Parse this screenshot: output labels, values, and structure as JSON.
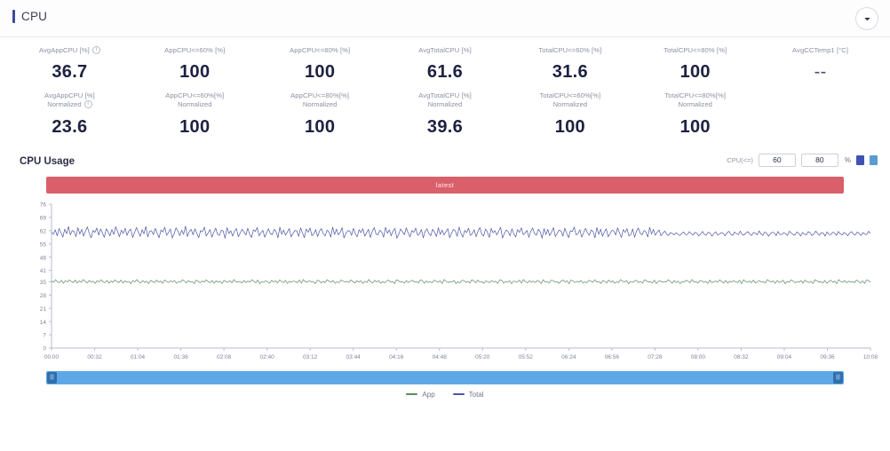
{
  "header": {
    "title": "CPU",
    "collapse_icon": "chevron-down-icon"
  },
  "kpis": {
    "row1": [
      {
        "label": "AvgAppCPU [%]",
        "info": true,
        "value": "36.7"
      },
      {
        "label": "AppCPU<=60% [%]",
        "info": false,
        "value": "100"
      },
      {
        "label": "AppCPU<=80% [%]",
        "info": false,
        "value": "100"
      },
      {
        "label": "AvgTotalCPU [%]",
        "info": false,
        "value": "61.6"
      },
      {
        "label": "TotalCPU<=60% [%]",
        "info": false,
        "value": "31.6"
      },
      {
        "label": "TotalCPU<=80% [%]",
        "info": false,
        "value": "100"
      },
      {
        "label": "AvgCCTemp1 [°C]",
        "info": false,
        "value": "--"
      }
    ],
    "row2": [
      {
        "label": "AvgAppCPU [%]",
        "sub": "Normalized",
        "info": true,
        "value": "23.6"
      },
      {
        "label": "AppCPU<=60%[%]",
        "sub": "Normalized",
        "info": false,
        "value": "100"
      },
      {
        "label": "AppCPU<=80%[%]",
        "sub": "Normalized",
        "info": false,
        "value": "100"
      },
      {
        "label": "AvgTotalCPU [%]",
        "sub": "Normalized",
        "info": false,
        "value": "39.6"
      },
      {
        "label": "TotalCPU<=60%[%]",
        "sub": "Normalized",
        "info": false,
        "value": "100"
      },
      {
        "label": "TotalCPU<=80%[%]",
        "sub": "Normalized",
        "info": false,
        "value": "100"
      },
      {
        "label": "",
        "sub": "",
        "info": false,
        "value": ""
      }
    ]
  },
  "chart_section": {
    "title": "CPU Usage",
    "controls": {
      "label": "CPU(<=)",
      "threshold_low": "60",
      "threshold_high": "80",
      "unit": "%",
      "icon_a": "bar-chart-icon",
      "icon_b": "line-chart-icon"
    },
    "alert_banner": {
      "text": "latest",
      "color": "#d9606a"
    },
    "legend_position": "bottom-center",
    "range_slider": {
      "left_handle": "range-start-handle",
      "right_handle": "range-end-handle",
      "fill_color": "#5fa8e8"
    }
  },
  "chart_data": {
    "type": "line",
    "title": "CPU Usage",
    "xlabel": "",
    "ylabel": "",
    "grid": false,
    "ylim": [
      0,
      76
    ],
    "yticks": [
      0,
      7,
      14,
      21,
      28,
      35,
      41,
      48,
      55,
      62,
      69,
      76
    ],
    "ytick_labels": [
      "0",
      "7",
      "14",
      "21",
      "28",
      "35",
      "41",
      "48",
      "55",
      "62",
      "69",
      "76"
    ],
    "xticks": [
      "00:00",
      "00:32",
      "01:04",
      "01:36",
      "02:08",
      "02:40",
      "03:12",
      "03:44",
      "04:16",
      "04:48",
      "05:20",
      "05:52",
      "06:24",
      "06:56",
      "07:28",
      "08:00",
      "08:32",
      "09:04",
      "09:36",
      "10:08"
    ],
    "series": [
      {
        "name": "Total",
        "color": "#4a55a8",
        "values": [
          61.2,
          60.1,
          62.4,
          59.3,
          63.1,
          61.0,
          58.6,
          62.8,
          60.4,
          64.2,
          59.8,
          62.1,
          61.5,
          58.9,
          63.6,
          60.2,
          62.7,
          59.1,
          61.8,
          64.0,
          60.6,
          58.3,
          62.2,
          61.1,
          63.4,
          59.7,
          62.9,
          60.8,
          58.5,
          63.0,
          61.4,
          59.2,
          62.6,
          60.0,
          64.1,
          61.7,
          58.8,
          62.3,
          60.5,
          63.3,
          59.5,
          61.9,
          62.8,
          58.4,
          60.9,
          63.7,
          61.2,
          59.0,
          62.5,
          60.3,
          64.3,
          58.7,
          61.6,
          62.0,
          59.9,
          63.2,
          60.7,
          58.2,
          62.4,
          61.3,
          63.8,
          59.6,
          61.0,
          62.9,
          58.1,
          60.4,
          63.5,
          61.8,
          59.4,
          62.2,
          60.1,
          64.4,
          58.9,
          61.5,
          62.7,
          59.8,
          63.0,
          60.6,
          58.3,
          62.1,
          61.4,
          63.9,
          59.2,
          60.8,
          62.6,
          58.6,
          61.1,
          63.4,
          60.0,
          59.5,
          62.3,
          61.7,
          58.0,
          63.6,
          60.5,
          62.0,
          59.1,
          61.9,
          63.1,
          58.8,
          60.7,
          62.8,
          61.2,
          59.7,
          63.3,
          60.2,
          58.4,
          62.5,
          61.6,
          63.7,
          59.3,
          60.9,
          62.2,
          58.5,
          61.0,
          63.0,
          60.4,
          59.9,
          62.7,
          61.5,
          58.2,
          63.8,
          60.1,
          62.4,
          59.6,
          61.3,
          63.2,
          58.7,
          60.6,
          62.1,
          61.8,
          59.0,
          63.5,
          60.8,
          58.3,
          62.9,
          61.1,
          63.4,
          59.4,
          60.3,
          62.6,
          58.9,
          61.7,
          63.1,
          60.5,
          59.2,
          62.3,
          61.4,
          58.6,
          63.9,
          60.0,
          62.8,
          59.8,
          61.2,
          63.6,
          58.1,
          60.7,
          62.0,
          61.9,
          59.5,
          63.3,
          60.4,
          58.8,
          62.5,
          61.0,
          63.0,
          59.1,
          60.9,
          62.7,
          58.4,
          61.6,
          63.7,
          60.2,
          59.7,
          62.2,
          61.3,
          58.5,
          63.8,
          60.6,
          62.4,
          59.3,
          61.8,
          63.2,
          58.0,
          60.1,
          62.9,
          61.5,
          59.9,
          63.5,
          60.8,
          58.7,
          62.1,
          61.1,
          63.4,
          59.6,
          60.3,
          62.6,
          58.2,
          61.7,
          63.0,
          60.5,
          59.4,
          62.8,
          61.2,
          58.9,
          63.6,
          60.0,
          62.3,
          59.8,
          61.4,
          63.1,
          58.3,
          60.7,
          62.7,
          61.9,
          59.0,
          63.9,
          60.6,
          58.6,
          62.2,
          61.0,
          63.3,
          59.5,
          60.4,
          62.5,
          58.8,
          61.6,
          63.7,
          60.1,
          59.2,
          62.9,
          61.3,
          58.4,
          63.2,
          60.9,
          62.0,
          59.7,
          61.8,
          63.8,
          58.1,
          60.5,
          62.4,
          61.5,
          59.3,
          63.0,
          60.2,
          58.7,
          62.6,
          61.1,
          63.5,
          59.9,
          60.8,
          62.1,
          58.5,
          61.7,
          63.4,
          60.3,
          59.6,
          62.8,
          61.4,
          58.0,
          63.1,
          60.0,
          62.7,
          59.4,
          61.2,
          63.6,
          58.9,
          60.6,
          62.3,
          61.8,
          59.1,
          63.3,
          60.7,
          58.3,
          62.0,
          61.5,
          63.9,
          59.8,
          60.4,
          62.5,
          58.6,
          61.0,
          63.2,
          60.9,
          59.5,
          62.4,
          61.6,
          58.2,
          63.7,
          60.1,
          62.8,
          59.0,
          61.3,
          63.0,
          58.8,
          60.5,
          62.2,
          61.9,
          59.7,
          63.5,
          60.8,
          58.4,
          62.6,
          61.1,
          63.1,
          59.2,
          60.0,
          62.9,
          58.5,
          61.7,
          63.4,
          60.6,
          59.9,
          62.1,
          61.4,
          58.7,
          63.8,
          60.3,
          62.7,
          59.6,
          61.2,
          62.4,
          59.3,
          60.7,
          61.8,
          60.2,
          59.5,
          61.0,
          60.5,
          59.8,
          60.9,
          60.1,
          59.4,
          60.6,
          61.3,
          59.9,
          60.0,
          61.5,
          60.4,
          59.7,
          61.1,
          60.8,
          59.2,
          60.3,
          61.6,
          60.0,
          59.6,
          61.2,
          60.7,
          59.1,
          60.5,
          61.4,
          59.8,
          60.2,
          61.0,
          60.6,
          59.3,
          60.9,
          61.7,
          60.1,
          59.5,
          61.3,
          60.4,
          59.9,
          61.8,
          60.0,
          59.7,
          60.8,
          61.5,
          60.3,
          59.4,
          61.1,
          60.6,
          59.8,
          61.9,
          60.2,
          59.6,
          61.4,
          60.7,
          59.0,
          60.5,
          61.2,
          60.9,
          59.3,
          61.6,
          60.1,
          59.9,
          61.0,
          60.4,
          59.5,
          61.7,
          60.8,
          60.0,
          59.7,
          61.3,
          60.6,
          59.2,
          61.1,
          60.3,
          59.8,
          61.5,
          60.9,
          59.4,
          60.2,
          61.8,
          60.5,
          59.6,
          61.0,
          60.7,
          59.1,
          61.4,
          60.0,
          59.9,
          61.2,
          60.8,
          59.5,
          61.6,
          60.3,
          59.7,
          61.1,
          60.4,
          59.3,
          60.9,
          61.5,
          60.1,
          59.8,
          61.3,
          60.6,
          59.4,
          61.0,
          60.2,
          59.9,
          61.7,
          60.5
        ]
      },
      {
        "name": "App",
        "color": "#5a8a5e",
        "values": [
          35.4,
          34.8,
          36.1,
          35.0,
          34.5,
          35.8,
          34.2,
          35.6,
          34.9,
          36.0,
          35.1,
          34.6,
          35.9,
          34.3,
          35.5,
          34.7,
          36.2,
          35.2,
          34.4,
          35.7,
          34.8,
          35.3,
          34.1,
          35.6,
          34.9,
          36.1,
          35.0,
          34.5,
          35.8,
          34.2,
          35.4,
          34.7,
          36.0,
          35.1,
          34.6,
          35.9,
          34.3,
          35.5,
          34.8,
          35.2,
          34.0,
          35.7,
          34.9,
          36.2,
          35.0,
          34.4,
          35.6,
          34.7,
          35.3,
          34.1,
          35.8,
          35.1,
          34.5,
          35.9,
          34.8,
          35.4,
          34.2,
          36.0,
          35.2,
          34.6,
          35.5,
          34.9,
          35.7,
          34.3,
          35.0,
          34.7,
          36.1,
          35.3,
          34.4,
          35.6,
          34.8,
          35.1,
          34.0,
          35.9,
          35.2,
          34.5,
          35.4,
          34.9,
          36.0,
          35.0,
          34.6,
          35.7,
          34.2,
          35.5,
          34.8,
          35.3,
          34.1,
          35.8,
          35.1,
          34.7,
          35.6,
          34.4,
          36.2,
          35.0,
          34.9,
          35.2,
          34.3,
          35.7,
          34.6,
          35.4,
          34.8,
          36.1,
          35.3,
          34.5,
          35.9,
          34.0,
          35.1,
          34.7,
          35.6,
          35.0,
          34.2,
          35.8,
          34.9,
          35.5,
          34.4,
          36.0,
          35.2,
          34.6,
          35.7,
          34.1,
          35.3,
          34.8,
          35.4,
          35.1,
          34.5,
          35.9,
          34.3,
          36.2,
          35.0,
          34.7,
          35.6,
          34.9,
          35.2,
          34.0,
          35.8,
          35.5,
          34.4,
          35.1,
          34.6,
          36.1,
          35.3,
          34.8,
          35.7,
          34.2,
          35.0,
          34.5,
          35.9,
          35.4,
          34.9,
          35.2,
          34.7,
          36.0,
          35.1,
          34.3,
          35.6,
          34.8,
          35.5,
          34.1,
          35.3,
          34.6,
          36.2,
          35.0,
          34.4,
          35.8,
          34.9,
          35.7,
          34.2,
          35.1,
          34.5,
          35.4,
          35.9,
          34.7,
          35.2,
          34.0,
          36.1,
          35.5,
          34.8,
          35.0,
          34.3,
          35.6,
          34.6,
          35.3,
          35.8,
          34.9,
          35.1,
          34.4,
          36.0,
          35.7,
          34.2,
          35.4,
          34.7,
          35.0,
          34.5,
          35.9,
          35.2,
          34.8,
          35.5,
          34.1,
          36.2,
          35.3,
          34.6,
          35.1,
          34.9,
          35.7,
          34.0,
          35.0,
          34.4,
          35.8,
          35.6,
          34.7,
          35.2,
          34.3,
          36.1,
          35.4,
          34.5,
          35.9,
          34.8,
          35.1,
          34.2,
          35.5,
          35.0,
          34.6,
          35.7,
          34.9,
          35.3,
          34.1,
          36.0,
          35.8,
          34.4,
          35.2,
          34.7,
          35.6,
          34.0,
          35.4,
          35.1,
          34.8,
          35.9,
          34.3,
          36.2,
          35.0,
          34.5,
          35.5,
          34.9,
          35.3,
          34.6,
          35.7,
          35.2,
          34.1,
          36.1,
          34.8,
          35.0,
          34.4,
          35.8,
          35.6,
          34.7,
          35.1,
          34.2,
          35.4,
          35.9,
          34.9,
          35.5,
          34.0,
          36.0,
          35.3,
          34.6,
          35.2,
          34.8,
          35.7,
          34.3,
          35.0,
          34.5,
          35.8,
          35.4,
          34.7,
          36.1,
          34.9,
          35.1,
          34.1,
          35.6,
          35.2,
          34.4,
          35.9,
          34.8,
          35.5,
          34.2,
          35.0,
          34.6,
          36.2,
          35.3,
          34.9,
          35.7,
          34.0,
          35.1,
          34.7,
          35.4,
          35.8,
          34.5,
          35.2,
          34.3,
          36.0,
          35.6,
          34.8,
          35.0,
          34.4,
          35.9,
          34.1,
          35.3,
          35.5,
          34.7,
          35.1,
          34.9,
          36.1,
          35.2,
          34.2,
          35.7,
          34.6,
          35.4,
          34.0,
          35.0,
          34.8,
          35.8,
          35.3,
          34.5,
          36.2,
          34.9,
          35.1,
          34.3,
          35.6,
          35.5,
          34.7,
          35.2,
          34.1,
          35.9,
          34.6,
          35.0,
          35.4,
          34.8,
          36.0,
          35.1,
          34.4,
          35.7,
          34.2,
          35.3,
          34.9,
          35.5,
          35.0,
          34.6,
          35.8,
          34.0,
          36.1,
          35.2,
          34.7,
          35.4,
          34.5,
          35.9,
          34.3,
          35.1,
          35.6,
          34.8,
          35.0,
          34.4,
          36.2,
          35.3,
          34.9,
          35.5,
          34.2,
          35.7,
          34.6,
          35.1,
          35.8,
          34.0,
          35.2,
          34.7,
          36.0,
          35.4,
          34.5,
          35.0,
          34.8,
          35.6,
          34.3,
          35.9,
          35.1,
          34.6,
          35.3,
          34.1,
          36.1,
          35.5,
          34.9,
          35.0,
          34.4,
          35.7,
          34.2,
          35.2,
          35.8,
          34.7,
          35.4,
          34.0,
          36.2,
          35.1,
          34.8,
          35.6,
          34.5,
          35.3,
          34.9,
          35.0,
          34.6,
          35.9,
          35.2,
          34.3,
          35.5,
          34.1,
          36.0,
          35.7,
          34.8
        ]
      }
    ],
    "legend": [
      {
        "label": "App",
        "color": "#5a8a5e"
      },
      {
        "label": "Total",
        "color": "#4a55a8"
      }
    ]
  }
}
